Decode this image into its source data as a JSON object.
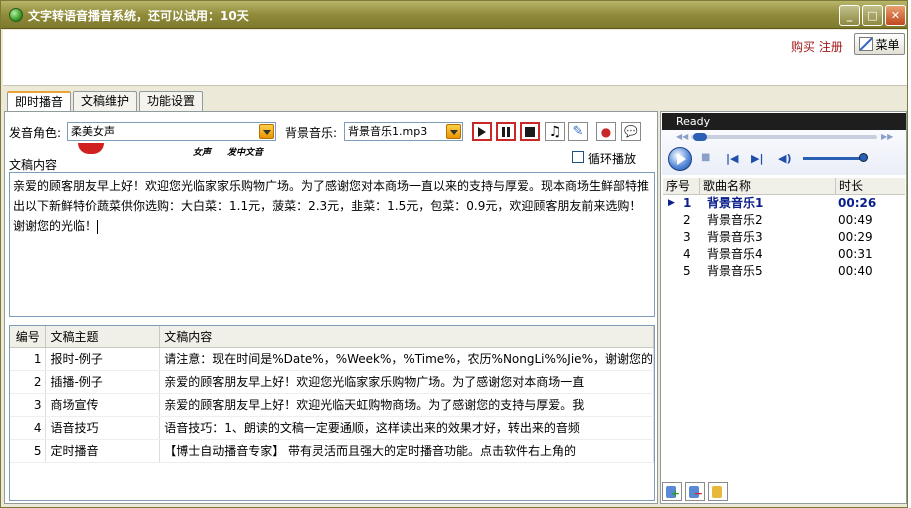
{
  "window": {
    "title": "文字转语音播音系统，还可以试用：10天",
    "min_icon": "minimize-icon",
    "max_icon": "maximize-icon",
    "close_icon": "close-icon"
  },
  "topbar": {
    "buy_label": "购买",
    "register_label": "注册",
    "menu_label": "菜单"
  },
  "tabs": [
    {
      "label": "即时播音",
      "active": true
    },
    {
      "label": "文稿维护",
      "active": false
    },
    {
      "label": "功能设置",
      "active": false
    }
  ],
  "controls": {
    "voice_label": "发音角色:",
    "voice_value": "柔美女声",
    "bgm_label": "背景音乐:",
    "bgm_value": "背景音乐1.mp3",
    "loop_label": "循环播放",
    "loop_checked": false,
    "script_left": "女声",
    "script_mid": "发中文音"
  },
  "manuscript": {
    "label": "文稿内容",
    "text": "亲爱的顾客朋友早上好！欢迎您光临家家乐购物广场。为了感谢您对本商场一直以来的支持与厚爱。现本商场生鲜部特推出以下新鲜特价蔬菜供你选购：大白菜：1.1元，菠菜：2.3元，韭菜：1.5元，包菜：0.9元，欢迎顾客朋友前来选购！谢谢您的光临！"
  },
  "table": {
    "headers": [
      "编号",
      "文稿主题",
      "文稿内容"
    ],
    "rows": [
      {
        "id": "1",
        "topic": "报时-例子",
        "content": "请注意：现在时间是%Date%，%Week%，%Time%，农历%NongLi%%Jie%，谢谢您的"
      },
      {
        "id": "2",
        "topic": "插播-例子",
        "content": "亲爱的顾客朋友早上好！欢迎您光临家家乐购物广场。为了感谢您对本商场一直"
      },
      {
        "id": "3",
        "topic": "商场宣传",
        "content": "亲爱的顾客朋友早上好！欢迎光临天虹购物商场。为了感谢您的支持与厚爱。我"
      },
      {
        "id": "4",
        "topic": "语音技巧",
        "content": "语音技巧：1、朗读的文稿一定要通顺，这样读出来的效果才好，转出来的音频"
      },
      {
        "id": "5",
        "topic": "定时播音",
        "content": "【博士自动播音专家】 带有灵活而且强大的定时播音功能。点击软件右上角的"
      }
    ]
  },
  "player": {
    "status": "Ready"
  },
  "playlist": {
    "headers": [
      "序号",
      "歌曲名称",
      "时长"
    ],
    "rows": [
      {
        "no": "1",
        "name": "背景音乐1",
        "duration": "00:26",
        "active": true
      },
      {
        "no": "2",
        "name": "背景音乐2",
        "duration": "00:49",
        "active": false
      },
      {
        "no": "3",
        "name": "背景音乐3",
        "duration": "00:29",
        "active": false
      },
      {
        "no": "4",
        "name": "背景音乐4",
        "duration": "00:31",
        "active": false
      },
      {
        "no": "5",
        "name": "背景音乐5",
        "duration": "00:40",
        "active": false
      }
    ]
  },
  "colors": {
    "titlebar": "#908c3a",
    "link": "#a01818",
    "tab_highlight": "#e8a436",
    "player_accent": "#2b5fb4",
    "active_track": "#0a1e8c"
  }
}
